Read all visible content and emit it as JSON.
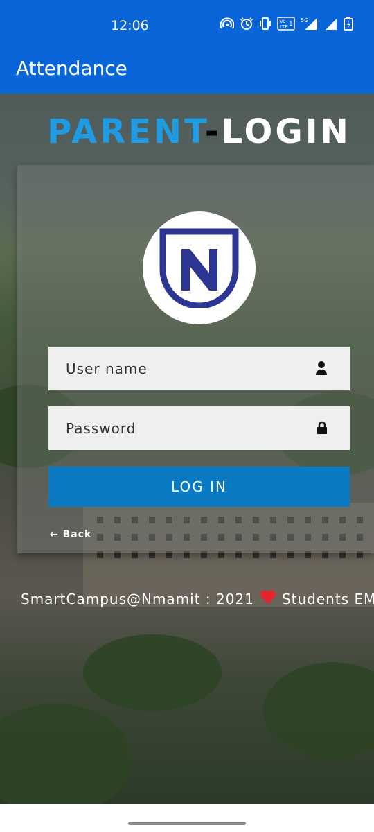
{
  "status_bar": {
    "time": "12:06",
    "icons": [
      "hotspot-icon",
      "alarm-icon",
      "vibrate-icon",
      "volte-icon",
      "5g-signal-icon",
      "signal-icon",
      "battery-icon"
    ]
  },
  "app_bar": {
    "title": "Attendance"
  },
  "headline": {
    "part1": "PARENT",
    "separator": "-",
    "part2": "LOGIN"
  },
  "form": {
    "username_placeholder": "User name",
    "password_placeholder": "Password",
    "login_label": "LOG IN",
    "back_label": "← Back"
  },
  "footer": {
    "left_text": "SmartCampus@Nmamit : 2021",
    "right_text": "Students EMS"
  },
  "colors": {
    "primary": "#0a66d8",
    "button": "#0a7ac2",
    "headline_accent": "#1e9be2",
    "heart": "#e3262e"
  }
}
